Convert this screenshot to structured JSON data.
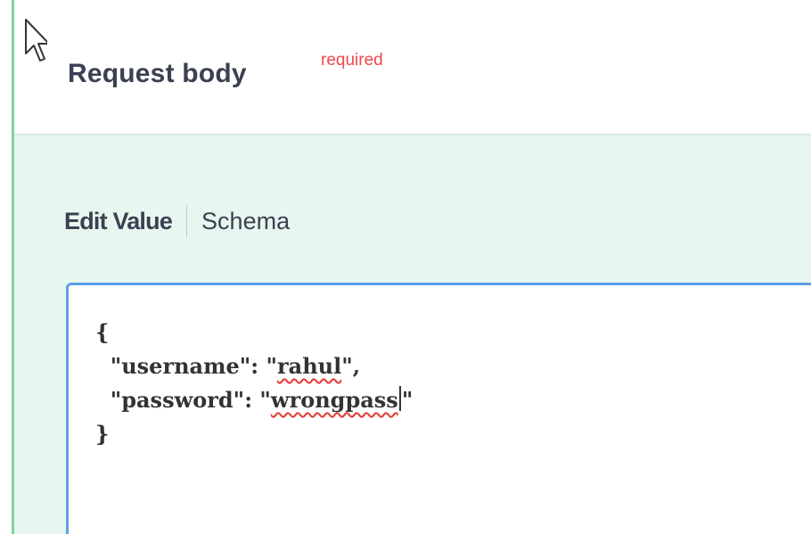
{
  "request_body": {
    "title": "Request body",
    "required_label": "required"
  },
  "tabs": {
    "edit_value": "Edit Value",
    "schema": "Schema"
  },
  "editor": {
    "open_brace": "{",
    "close_brace": "}",
    "lines": [
      {
        "key": "\"username\"",
        "colon": ": ",
        "quote_open": "\"",
        "value": "rahul",
        "quote_close": "\"",
        "trailing": ","
      },
      {
        "key": "\"password\"",
        "colon": ": ",
        "quote_open": "\"",
        "value": "wrongpass",
        "quote_close": "\"",
        "trailing": ""
      }
    ]
  },
  "colors": {
    "accent_green": "#7cd3a3",
    "body_bg": "#e8f6f0",
    "required_red": "#f04848",
    "editor_border": "#5aa0e6",
    "text_dark": "#3b4151"
  },
  "icons": {
    "cursor": "mouse-pointer-icon"
  }
}
